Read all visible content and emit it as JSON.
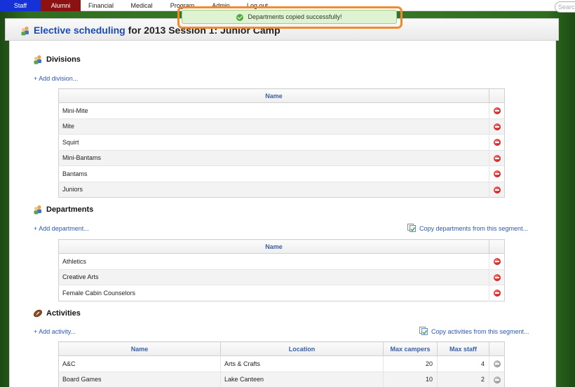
{
  "nav": {
    "tabs": [
      {
        "label": "Staff"
      },
      {
        "label": "Alumni"
      },
      {
        "label": "Financial"
      },
      {
        "label": "Medical"
      },
      {
        "label": "Program"
      },
      {
        "label": "Admin"
      },
      {
        "label": "Log out"
      }
    ],
    "search_placeholder": "Search"
  },
  "toast": {
    "message": "Departments copied successfully!",
    "icon": "check-circle-icon",
    "highlight_color": "#f08a2c"
  },
  "header": {
    "title_link": "Elective scheduling",
    "title_rest": " for 2013 Session 1: Junior Camp"
  },
  "divisions": {
    "title": "Divisions",
    "add_label": "+ Add division...",
    "column": "Name",
    "rows": [
      "Mini-Mite",
      "Mite",
      "Squirt",
      "Mini-Bantams",
      "Bantams",
      "Juniors"
    ]
  },
  "departments": {
    "title": "Departments",
    "add_label": "+ Add department...",
    "copy_label": "Copy departments from this segment...",
    "column": "Name",
    "rows": [
      "Athletics",
      "Creative Arts",
      "Female Cabin Counselors"
    ]
  },
  "activities": {
    "title": "Activities",
    "add_label": "+ Add activity...",
    "copy_label": "Copy activities from this segment...",
    "columns": [
      "Name",
      "Location",
      "Max campers",
      "Max staff"
    ],
    "rows": [
      {
        "name": "A&C",
        "location": "Arts & Crafts",
        "max_campers": "20",
        "max_staff": "4"
      },
      {
        "name": "Board Games",
        "location": "Lake Canteen",
        "max_campers": "10",
        "max_staff": "2"
      }
    ]
  }
}
